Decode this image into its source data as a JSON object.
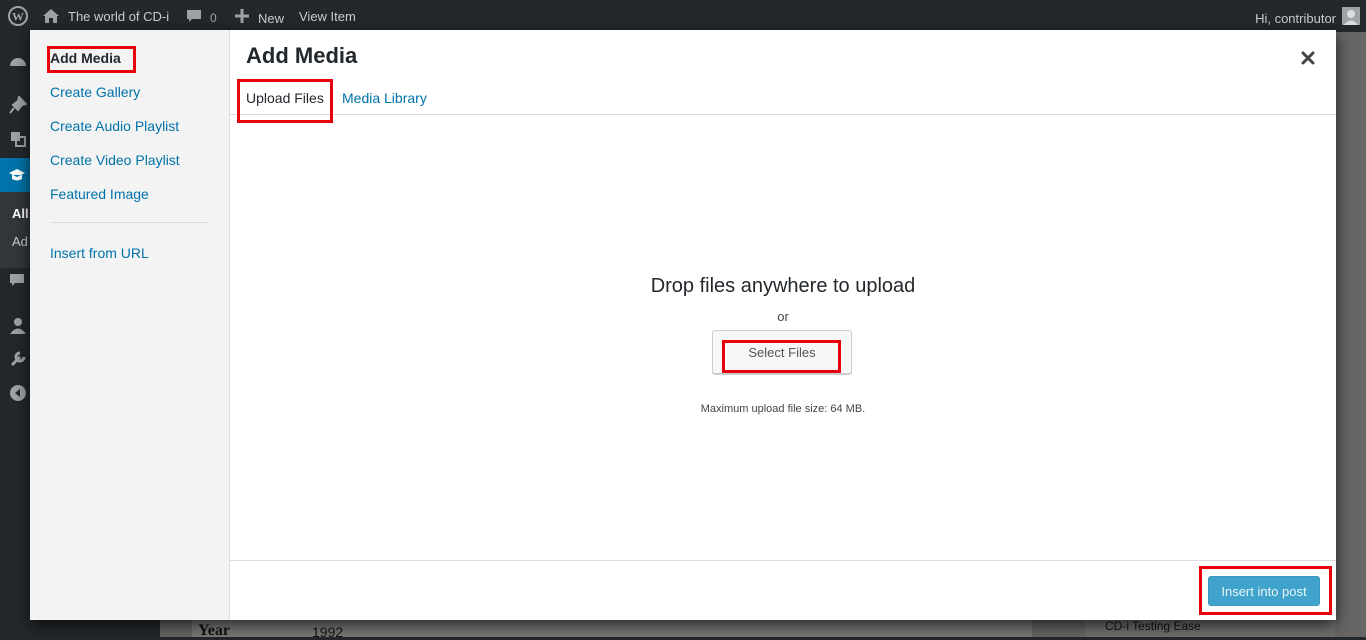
{
  "admin_bar": {
    "site_name": "The world of CD-i",
    "comment_count": "0",
    "new_label": "New",
    "view_item_label": "View Item",
    "greeting": "Hi, contributor"
  },
  "background": {
    "sidebar_partial_labels": [
      "All",
      "Ad"
    ],
    "year_label": "Year",
    "year_value": "1992",
    "right_panel_text": "CD-i Testing Ease"
  },
  "modal": {
    "title": "Add Media",
    "menu": {
      "items": [
        {
          "label": "Add Media",
          "active": true
        },
        {
          "label": "Create Gallery"
        },
        {
          "label": "Create Audio Playlist"
        },
        {
          "label": "Create Video Playlist"
        },
        {
          "label": "Featured Image"
        },
        {
          "label": "Insert from URL"
        }
      ]
    },
    "tabs": [
      {
        "label": "Upload Files",
        "active": true
      },
      {
        "label": "Media Library"
      }
    ],
    "upload": {
      "drop_text": "Drop files anywhere to upload",
      "or_text": "or",
      "select_button": "Select Files",
      "max_size_text": "Maximum upload file size: 64 MB."
    },
    "toolbar": {
      "insert_button": "Insert into post"
    }
  },
  "colors": {
    "link": "#0073aa",
    "primary_button": "#0085ba",
    "highlight": "#e8000b",
    "admin_bar": "#23282d"
  }
}
